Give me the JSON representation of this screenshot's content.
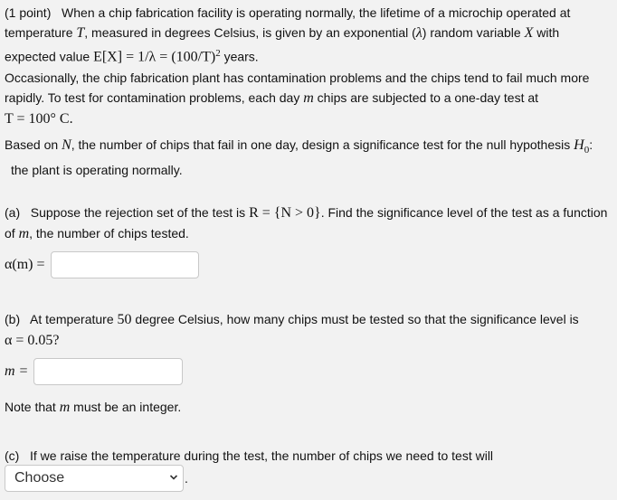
{
  "intro": {
    "points": "(1 point)",
    "text1": "When a chip fabrication facility is operating normally, the lifetime of a microchip operated at temperature ",
    "var_T": "T",
    "text2": ", measured in degrees Celsius, is given by an exponential (",
    "lambda": "λ",
    "text3": ") random variable ",
    "var_X": "X",
    "text4": " with expected value ",
    "formula": "E[X] = 1/λ = (100/T)",
    "formula_sup": "2",
    "text5": " years."
  },
  "context": {
    "text1": "Occasionally, the chip fabrication plant has contamination problems and the chips tend to fail much more rapidly. To test for contamination problems, each day ",
    "var_m": "m",
    "text2": " chips are subjected to a one-day test at",
    "temp": "T = 100° C."
  },
  "hypothesis": {
    "text1": "Based on ",
    "var_N": "N",
    "text2": ", the number of chips that fail in one day, design a significance test for the null hypothesis ",
    "H": "H",
    "H_sub": "0",
    "colon": ":",
    "text3": "the plant is operating normally."
  },
  "part_a": {
    "label": "(a)",
    "text1": "Suppose the rejection set of the test is ",
    "set": "R = {N > 0}",
    "text2": ". Find the significance level of the test as a function of ",
    "var_m": "m",
    "text3": ", the number of chips tested.",
    "answer_label": "α(m) =",
    "answer_value": ""
  },
  "part_b": {
    "label": "(b)",
    "text1": "At temperature ",
    "temp": "50",
    "text2": " degree Celsius, how many chips must be tested so that the significance level is ",
    "alpha": "α = 0.05?",
    "answer_label": "m =",
    "answer_value": "",
    "note1": "Note that ",
    "note_var": "m",
    "note2": " must be an integer."
  },
  "part_c": {
    "label": "(c)",
    "text": "If we raise the temperature during the test, the number of chips we need to test will",
    "select_value": "Choose",
    "period": "."
  }
}
